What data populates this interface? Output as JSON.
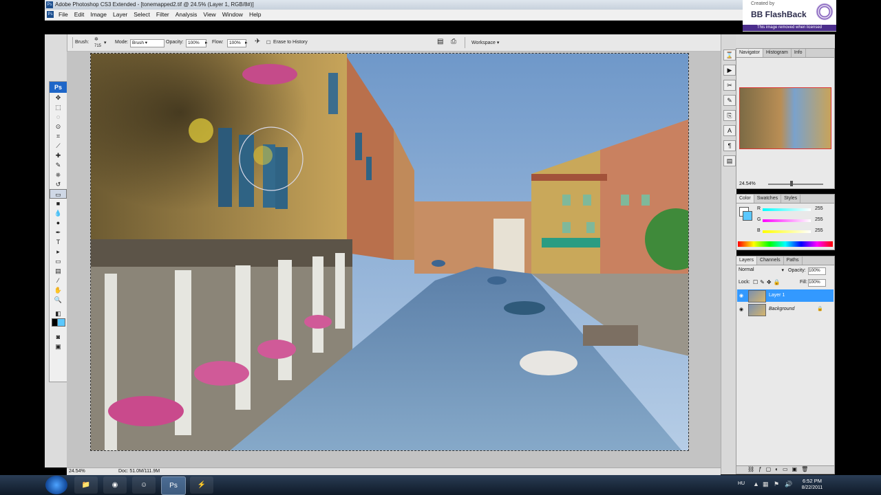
{
  "window": {
    "title": "Adobe Photoshop CS3 Extended - [tonemapped2.tif @ 24.5% (Layer 1, RGB/8#)]"
  },
  "menu": [
    "File",
    "Edit",
    "Image",
    "Layer",
    "Select",
    "Filter",
    "Analysis",
    "View",
    "Window",
    "Help"
  ],
  "watermark": {
    "created": "Created by",
    "brand": "BB FlashBack",
    "notice": "This image removed when licensed"
  },
  "options": {
    "brush_label": "Brush:",
    "brush_size": "715",
    "mode_label": "Mode:",
    "mode_value": "Brush",
    "opacity_label": "Opacity:",
    "opacity_value": "100%",
    "flow_label": "Flow:",
    "flow_value": "100%",
    "erase_history": "Erase to History",
    "workspace": "Workspace ▾"
  },
  "tools": {
    "ps": "Ps",
    "icons": [
      "move-icon",
      "marquee-icon",
      "lasso-icon",
      "quick-select-icon",
      "crop-icon",
      "slice-icon",
      "healing-icon",
      "brush-icon",
      "stamp-icon",
      "history-brush-icon",
      "eraser-icon",
      "gradient-icon",
      "blur-icon",
      "dodge-icon",
      "pen-icon",
      "type-icon",
      "path-select-icon",
      "shape-icon",
      "notes-icon",
      "eyedropper-icon",
      "hand-icon",
      "zoom-icon"
    ],
    "glyphs": [
      "✥",
      "⬚",
      "◌",
      "⊙",
      "⌗",
      "⟋",
      "✚",
      "✎",
      "⎈",
      "↺",
      "▭",
      "■",
      "💧",
      "●",
      "✒",
      "T",
      "▸",
      "▭",
      "▤",
      "⁄",
      "✋",
      "🔍"
    ]
  },
  "status": {
    "zoom": "24.54%",
    "doc": "Doc: 51.0M/111.9M"
  },
  "navigator": {
    "tabs": [
      "Navigator",
      "Histogram",
      "Info"
    ],
    "zoom": "24.54%"
  },
  "color": {
    "tabs": [
      "Color",
      "Swatches",
      "Styles"
    ],
    "r_label": "R",
    "r_value": "255",
    "g_label": "G",
    "g_value": "255",
    "b_label": "B",
    "b_value": "255"
  },
  "layers": {
    "tabs": [
      "Layers",
      "Channels",
      "Paths"
    ],
    "blend_mode": "Normal",
    "opacity_label": "Opacity:",
    "opacity_value": "100%",
    "lock_label": "Lock:",
    "fill_label": "Fill:",
    "fill_value": "100%",
    "items": [
      {
        "name": "Layer 1"
      },
      {
        "name": "Background"
      }
    ]
  },
  "taskbar": {
    "lang": "HU",
    "time": "6:52 PM",
    "date": "8/22/2011"
  },
  "colors": {
    "accent": "#3399ff",
    "titlebar": "#c7d1dc",
    "canvas_bg": "#c3c3c3"
  }
}
